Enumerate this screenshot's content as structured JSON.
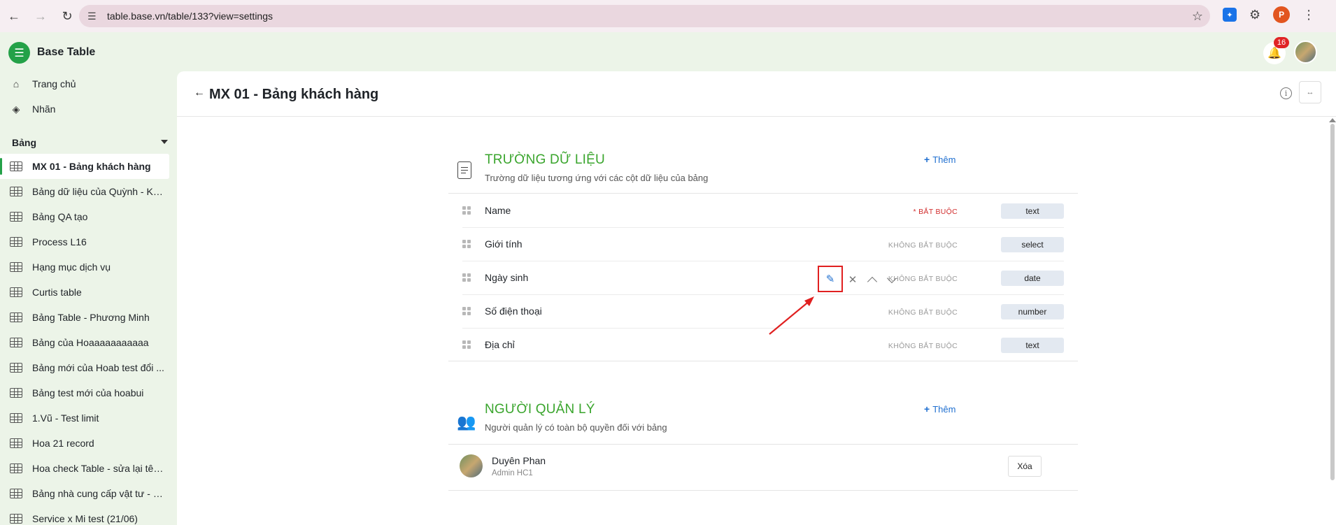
{
  "browser": {
    "url": "table.base.vn/table/133?view=settings",
    "profile_initial": "P"
  },
  "app": {
    "title": "Base Table",
    "notification_count": "16"
  },
  "sidebar": {
    "links": [
      {
        "label": "Trang chủ",
        "icon": "home-icon"
      },
      {
        "label": "Nhãn",
        "icon": "tag-icon"
      }
    ],
    "section_title": "Bảng",
    "tables": [
      {
        "label": "MX 01 - Bảng khách hàng",
        "active": true
      },
      {
        "label": "Bảng dữ liệu của Quỳnh - KH..."
      },
      {
        "label": "Bảng QA tạo"
      },
      {
        "label": "Process L16"
      },
      {
        "label": "Hạng mục dịch vụ"
      },
      {
        "label": "Curtis table"
      },
      {
        "label": "Bảng Table - Phương Minh"
      },
      {
        "label": "Bảng của Hoaaaaaaaaaaa"
      },
      {
        "label": "Bảng mới của Hoab test đổi ..."
      },
      {
        "label": "Bảng test mới của hoabui"
      },
      {
        "label": "1.Vũ - Test limit"
      },
      {
        "label": "Hoa 21 record"
      },
      {
        "label": "Hoa check Table - sửa lại tên..."
      },
      {
        "label": "Bảng nhà cung cấp vật tư - CE"
      },
      {
        "label": "Service x Mi test (21/06)"
      }
    ]
  },
  "main": {
    "page_title": "MX 01 - Bảng khách hàng",
    "fields_section": {
      "title": "TRƯỜNG DỮ LIỆU",
      "subtitle": "Trường dữ liệu tương ứng với các cột dữ liệu của bảng",
      "add_label": "Thêm",
      "fields": [
        {
          "name": "Name",
          "requirement": "* BẮT BUỘC",
          "required": true,
          "type": "text"
        },
        {
          "name": "Giới tính",
          "requirement": "KHÔNG BẮT BUỘC",
          "required": false,
          "type": "select"
        },
        {
          "name": "Ngày sinh",
          "requirement": "KHÔNG BẮT BUỘC",
          "required": false,
          "type": "date"
        },
        {
          "name": "Số điện thoại",
          "requirement": "KHÔNG BẮT BUỘC",
          "required": false,
          "type": "number"
        },
        {
          "name": "Địa chỉ",
          "requirement": "KHÔNG BẮT BUỘC",
          "required": false,
          "type": "text"
        }
      ]
    },
    "managers_section": {
      "title": "NGƯỜI QUẢN LÝ",
      "subtitle": "Người quản lý có toàn bộ quyền đối với bảng",
      "add_label": "Thêm",
      "managers": [
        {
          "name": "Duyên Phan",
          "role": "Admin HC1",
          "delete_label": "Xóa"
        }
      ]
    }
  },
  "colors": {
    "accent_green": "#3aa52d",
    "link_blue": "#1f6fd0",
    "required_red": "#d12d2d",
    "highlight_red": "#e02020"
  }
}
